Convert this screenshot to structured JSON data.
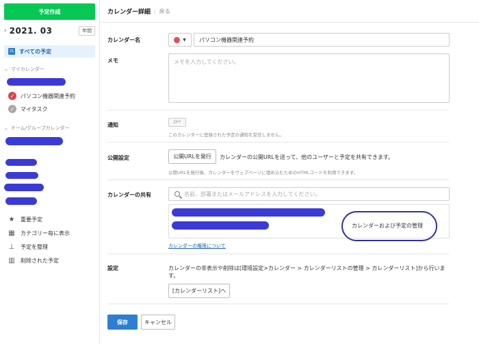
{
  "sidebar": {
    "create_label": "予定作成",
    "month": "2021. 03",
    "chevron": "›",
    "year_button": "年間",
    "all_plans": "すべての予定",
    "all_plans_icon_text": "31",
    "my_calendars_head": "マイカレンダー",
    "my_calendars": [
      {
        "label": "パソコン機器関連予約",
        "color": "#d9454b"
      },
      {
        "label": "マイタスク",
        "color": "#a8a8a8"
      }
    ],
    "team_calendars_head": "チーム/グループカレンダー",
    "tools": [
      {
        "label": "重要予定",
        "icon": "star-icon",
        "glyph": "★"
      },
      {
        "label": "カテゴリー毎に表示",
        "icon": "grid-icon",
        "glyph": "▦"
      },
      {
        "label": "予定を整理",
        "icon": "broom-icon",
        "glyph": "⊥"
      },
      {
        "label": "削除された予定",
        "icon": "trash-icon",
        "glyph": "▥"
      }
    ]
  },
  "header": {
    "title": "カレンダー詳細",
    "back": "戻る"
  },
  "form": {
    "name_label": "カレンダー名",
    "name_value": "パソコン機器関連予約",
    "calendar_color": "#e34e55",
    "memo_label": "メモ",
    "memo_placeholder": "メモを入力してください。",
    "notify_label": "通知",
    "notify_toggle": "OFF",
    "notify_hint": "このカレンダーに登録された予定の通知を受信しません。",
    "public_label": "公開設定",
    "public_button": "公開URLを発行",
    "public_text": "カレンダーの公開URLを送って、他のユーザーと予定を共有できます。",
    "public_hint": "公開URLを発行後、カレンダーをウェブページに埋め込むためのHTMLコードを利用できます。",
    "share_label": "カレンダーの共有",
    "share_placeholder": "名前、部署またはメールアドレスを入力してください。",
    "permission": "カレンダーおよび予定の管理",
    "permission_link": "カレンダーの権限について",
    "settings_label": "設定",
    "settings_text": "カレンダーの非表示や削除は[環境設定>カレンダー > カレンダーリストの管理 > カレンダーリスト]から行います。",
    "settings_button": "[カレンダーリスト]へ",
    "save": "保存",
    "cancel": "キャンセル"
  },
  "colors": {
    "accent_green": "#07c755",
    "accent_blue": "#2e7fd1",
    "redaction": "#3a3bd6"
  }
}
